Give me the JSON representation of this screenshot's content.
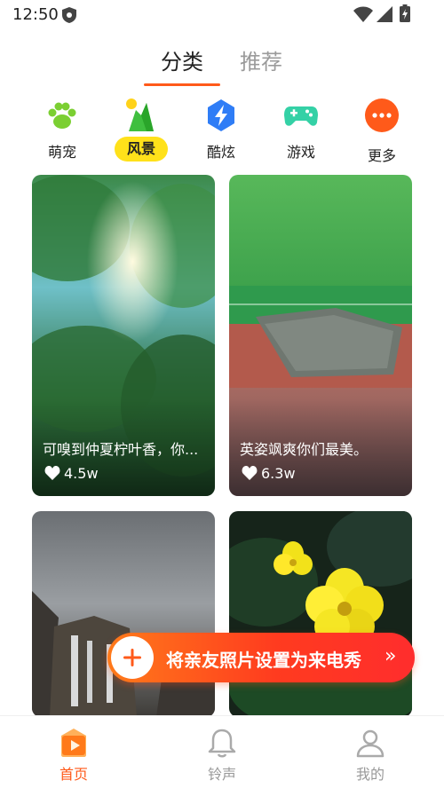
{
  "status_bar": {
    "time": "12:50"
  },
  "top_tabs": {
    "categories": "分类",
    "recommended": "推荐"
  },
  "categories": [
    {
      "label": "萌宠",
      "icon": "paw-icon",
      "selected": false
    },
    {
      "label": "风景",
      "icon": "mountain-icon",
      "selected": true
    },
    {
      "label": "酷炫",
      "icon": "lightning-icon",
      "selected": false
    },
    {
      "label": "游戏",
      "icon": "gamepad-icon",
      "selected": false
    },
    {
      "label": "更多",
      "icon": "more-icon",
      "selected": false
    }
  ],
  "cards": [
    {
      "caption": "可嗅到仲夏柠叶香，你...",
      "likes": "4.5w"
    },
    {
      "caption": "英姿飒爽你们最美。",
      "likes": "6.3w"
    },
    {
      "caption": "",
      "likes": ""
    },
    {
      "caption": "",
      "likes": ""
    }
  ],
  "promo": {
    "text": "将亲友照片设置为来电秀",
    "arrow": "»"
  },
  "bottom_nav": [
    {
      "label": "首页",
      "icon": "home-play-icon",
      "active": true
    },
    {
      "label": "铃声",
      "icon": "bell-icon",
      "active": false
    },
    {
      "label": "我的",
      "icon": "user-icon",
      "active": false
    }
  ],
  "colors": {
    "accent": "#ff5a1a",
    "selected_pill": "#ffe11a",
    "inactive": "#999999"
  }
}
